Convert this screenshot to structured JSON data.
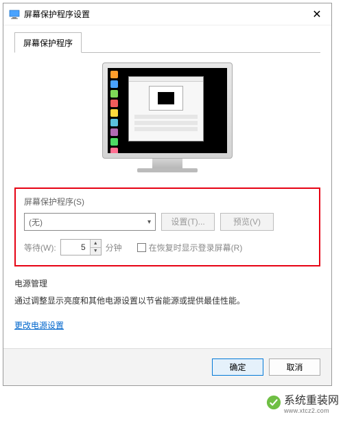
{
  "window": {
    "title": "屏幕保护程序设置",
    "close_glyph": "✕"
  },
  "tab": {
    "label": "屏幕保护程序"
  },
  "section": {
    "group_title": "屏幕保护程序(S)",
    "dropdown_value": "(无)",
    "settings_btn": "设置(T)...",
    "preview_btn": "预览(V)",
    "wait_label": "等待(W):",
    "wait_value": "5",
    "wait_unit": "分钟",
    "resume_checkbox_label": "在恢复时显示登录屏幕(R)"
  },
  "power": {
    "header": "电源管理",
    "text": "通过调整显示亮度和其他电源设置以节省能源或提供最佳性能。",
    "link": "更改电源设置"
  },
  "buttons": {
    "ok": "确定",
    "cancel": "取消"
  },
  "watermark": {
    "text": "系统重装网",
    "url": "www.xtcz2.com"
  },
  "icon_colors": [
    "#ff9e2c",
    "#4aa3ff",
    "#7ed957",
    "#f15b5b",
    "#ffd93d",
    "#5bc0de",
    "#b06ab3",
    "#4cd964",
    "#ff6f91",
    "#c9c9c9",
    "#4aa3ff",
    "#ffd93d"
  ]
}
